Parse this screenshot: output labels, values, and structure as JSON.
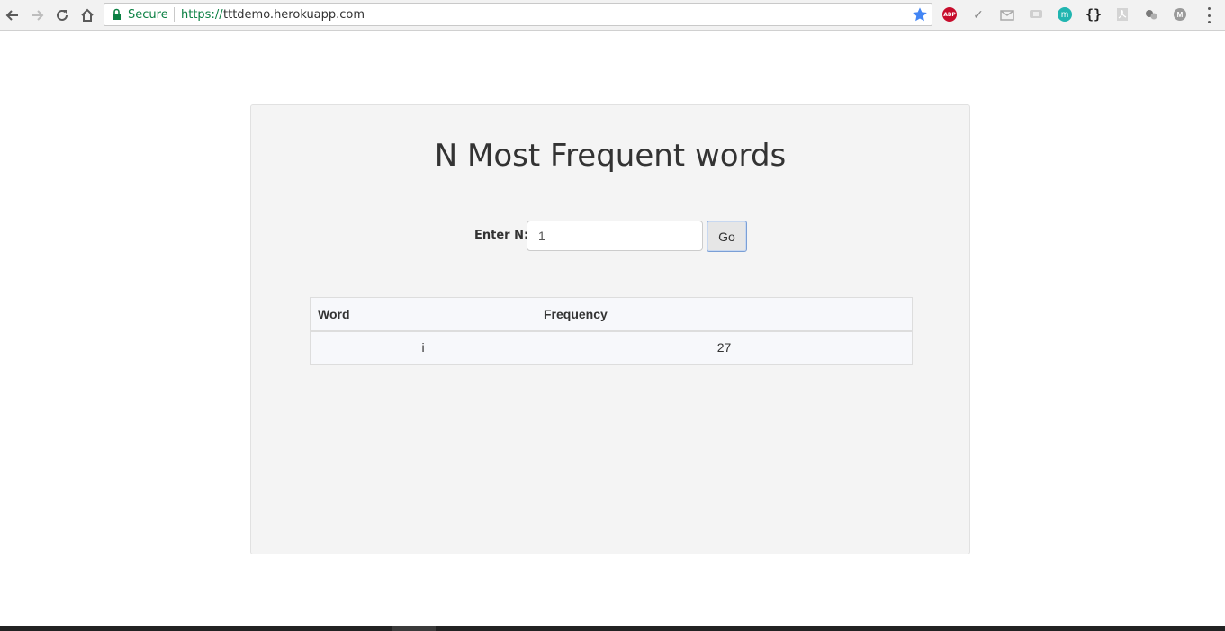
{
  "browser": {
    "security_label": "Secure",
    "url_scheme": "https://",
    "url_host": "tttdemo.herokuapp.com",
    "extensions": [
      {
        "name": "adblock-plus-icon",
        "text": "ABP"
      },
      {
        "name": "checkmark-extension-icon"
      },
      {
        "name": "mail-extension-icon"
      },
      {
        "name": "chat-extension-icon"
      },
      {
        "name": "m-extension-icon",
        "text": "m"
      },
      {
        "name": "json-viewer-icon",
        "text": "{}"
      },
      {
        "name": "pdf-extension-icon"
      },
      {
        "name": "puzzle-extension-icon"
      },
      {
        "name": "profile-extension-icon",
        "text": "M"
      }
    ]
  },
  "page": {
    "title": "N Most Frequent words",
    "form": {
      "label": "Enter N:",
      "input_value": "1",
      "submit_label": "Go"
    },
    "table": {
      "headers": [
        "Word",
        "Frequency"
      ],
      "rows": [
        [
          "i",
          "27"
        ]
      ]
    }
  }
}
